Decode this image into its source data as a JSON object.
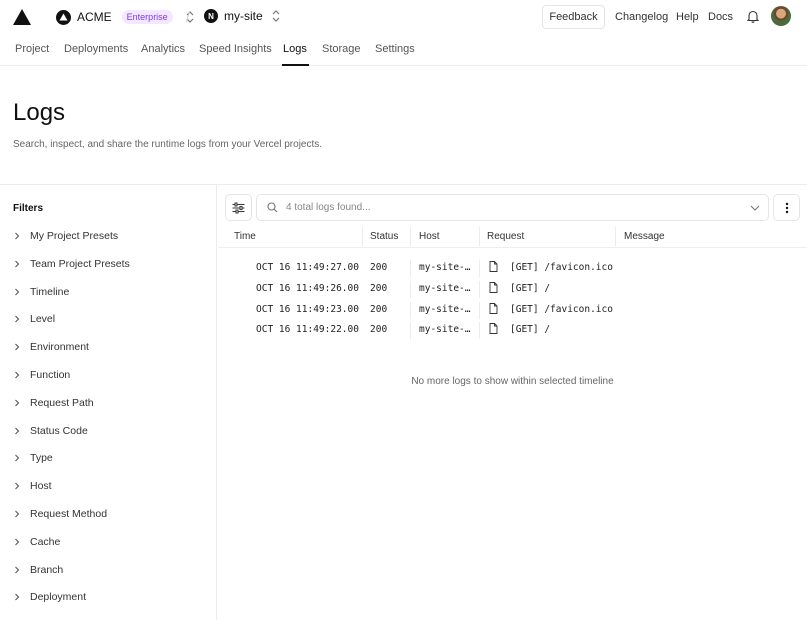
{
  "topbar": {
    "team_name": "ACME",
    "team_plan": "Enterprise",
    "separator": "/",
    "project_name": "my-site",
    "project_initial": "N",
    "feedback": "Feedback",
    "links": [
      "Changelog",
      "Help",
      "Docs"
    ]
  },
  "tabs": [
    "Project",
    "Deployments",
    "Analytics",
    "Speed Insights",
    "Logs",
    "Storage",
    "Settings"
  ],
  "active_tab": "Logs",
  "page": {
    "title": "Logs",
    "subtitle": "Search, inspect, and share the runtime logs from your Vercel projects."
  },
  "sidebar": {
    "title": "Filters",
    "filters": [
      "My Project Presets",
      "Team Project Presets",
      "Timeline",
      "Level",
      "Environment",
      "Function",
      "Request Path",
      "Status Code",
      "Type",
      "Host",
      "Request Method",
      "Cache",
      "Branch",
      "Deployment"
    ]
  },
  "search": {
    "placeholder": "4 total logs found..."
  },
  "table": {
    "columns": [
      "Time",
      "Status",
      "Host",
      "Request",
      "Message"
    ],
    "rows": [
      {
        "time": "OCT 16 11:49:27.00",
        "status": "200",
        "host": "my-site-…",
        "request": "[GET] /favicon.ico",
        "message": ""
      },
      {
        "time": "OCT 16 11:49:26.00",
        "status": "200",
        "host": "my-site-…",
        "request": "[GET] /",
        "message": ""
      },
      {
        "time": "OCT 16 11:49:23.00",
        "status": "200",
        "host": "my-site-…",
        "request": "[GET] /favicon.ico",
        "message": ""
      },
      {
        "time": "OCT 16 11:49:22.00",
        "status": "200",
        "host": "my-site-…",
        "request": "[GET] /",
        "message": ""
      }
    ],
    "empty_message": "No more logs to show within selected timeline"
  }
}
